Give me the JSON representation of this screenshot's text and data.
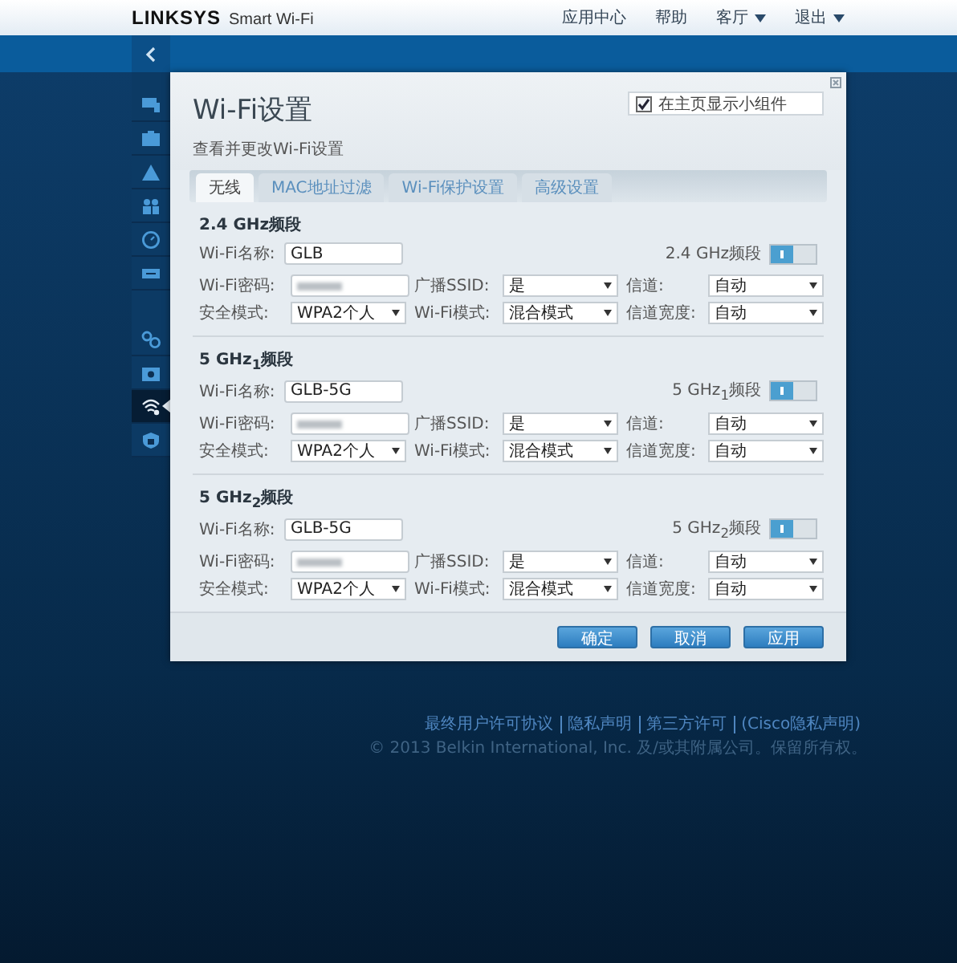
{
  "header": {
    "logo": "LINKSYS",
    "product": "Smart Wi-Fi",
    "menu": [
      {
        "label": "应用中心",
        "dropdown": false
      },
      {
        "label": "帮助",
        "dropdown": false
      },
      {
        "label": "客厅",
        "dropdown": true
      },
      {
        "label": "退出",
        "dropdown": true
      }
    ]
  },
  "sidebar": {
    "items": [
      {
        "selected": false
      },
      {
        "selected": false
      },
      {
        "selected": false
      },
      {
        "selected": false
      },
      {
        "selected": false
      },
      {
        "selected": false
      },
      {
        "selected": false
      },
      {
        "selected": false
      },
      {
        "selected": true
      },
      {
        "selected": false
      }
    ]
  },
  "dialog": {
    "title": "Wi-Fi设置",
    "subtitle": "查看并更改Wi-Fi设置",
    "widget_checkbox": {
      "label": "在主页显示小组件",
      "checked": true
    },
    "tabs": [
      {
        "label": "无线",
        "selected": true
      },
      {
        "label": "MAC地址过滤",
        "selected": false
      },
      {
        "label": "Wi-Fi保护设置",
        "selected": false
      },
      {
        "label": "高级设置",
        "selected": false
      }
    ],
    "sections": [
      {
        "title": "2.4 GHz频段",
        "name_label": "Wi-Fi名称:",
        "name": "GLB",
        "toggle_label": "2.4 GHz频段",
        "enabled": true,
        "fields": [
          {
            "label": "Wi-Fi密码:",
            "kind": "password"
          },
          {
            "label": "广播SSID:",
            "kind": "select",
            "value": "是"
          },
          {
            "label": "信道:",
            "kind": "select",
            "value": "自动"
          },
          {
            "label": "安全模式:",
            "kind": "select",
            "value": "WPA2个人"
          },
          {
            "label": "Wi-Fi模式:",
            "kind": "select",
            "value": "混合模式"
          },
          {
            "label": "信道宽度:",
            "kind": "select",
            "value": "自动"
          }
        ]
      },
      {
        "title": "5 GHz$_{1}$频段",
        "name_label": "Wi-Fi名称:",
        "name": "GLB-5G",
        "toggle_label": "5 GHz$_{1}$频段",
        "enabled": true,
        "fields": [
          {
            "label": "Wi-Fi密码:",
            "kind": "password"
          },
          {
            "label": "广播SSID:",
            "kind": "select",
            "value": "是"
          },
          {
            "label": "信道:",
            "kind": "select",
            "value": "自动"
          },
          {
            "label": "安全模式:",
            "kind": "select",
            "value": "WPA2个人"
          },
          {
            "label": "Wi-Fi模式:",
            "kind": "select",
            "value": "混合模式"
          },
          {
            "label": "信道宽度:",
            "kind": "select",
            "value": "自动"
          }
        ]
      },
      {
        "title": "5 GHz$_{2}$频段",
        "name_label": "Wi-Fi名称:",
        "name": "GLB-5G",
        "toggle_label": "5 GHz$_{2}$频段",
        "enabled": true,
        "fields": [
          {
            "label": "Wi-Fi密码:",
            "kind": "password"
          },
          {
            "label": "广播SSID:",
            "kind": "select",
            "value": "是"
          },
          {
            "label": "信道:",
            "kind": "select",
            "value": "自动"
          },
          {
            "label": "安全模式:",
            "kind": "select",
            "value": "WPA2个人"
          },
          {
            "label": "Wi-Fi模式:",
            "kind": "select",
            "value": "混合模式"
          },
          {
            "label": "信道宽度:",
            "kind": "select",
            "value": "自动"
          }
        ]
      }
    ],
    "buttons": [
      "确定",
      "取消",
      "应用"
    ]
  },
  "footer": {
    "links": [
      "最终用户许可协议",
      "隐私声明",
      "第三方许可",
      "(Cisco隐私声明)"
    ],
    "copyright": "© 2013 Belkin International, Inc. 及/或其附属公司。保留所有权。"
  }
}
